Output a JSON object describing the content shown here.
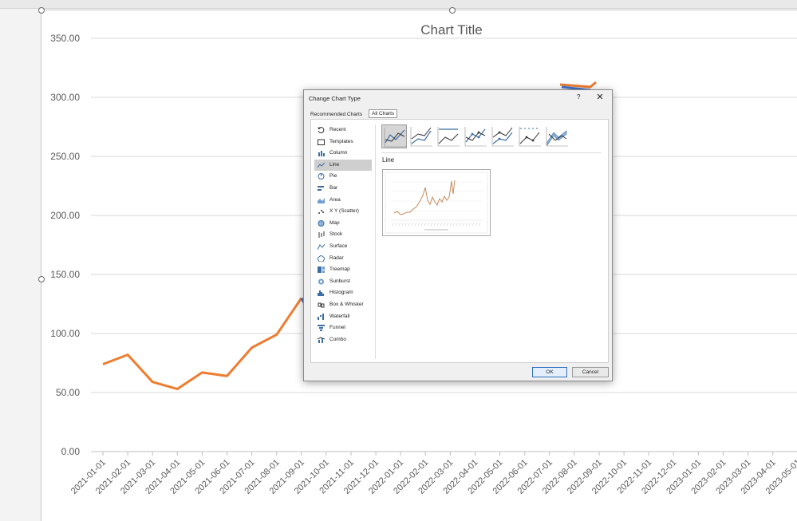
{
  "chart": {
    "title": "Chart Title",
    "y_ticks": [
      "350.00",
      "300.00",
      "250.00",
      "200.00",
      "150.00",
      "100.00",
      "50.00",
      "0.00"
    ],
    "x_ticks": [
      "2021-01-01",
      "2021-02-01",
      "2021-03-01",
      "2021-04-01",
      "2021-05-01",
      "2021-06-01",
      "2021-07-01",
      "2021-08-01",
      "2021-09-01",
      "2021-10-01",
      "2021-11-01",
      "2021-12-01",
      "2022-01-01",
      "2022-02-01",
      "2022-03-01",
      "2022-04-01",
      "2022-05-01",
      "2022-06-01",
      "2022-07-01",
      "2022-08-01",
      "2022-09-01",
      "2022-10-01",
      "2022-11-01",
      "2022-12-01",
      "2023-01-01",
      "2023-02-01",
      "2023-03-01",
      "2023-04-01",
      "2023-05-01"
    ],
    "series_color": "#ed7d31",
    "hidden_series_color": "#4472c4"
  },
  "chart_data": {
    "type": "line",
    "title": "Chart Title",
    "ylim": [
      0,
      350
    ],
    "grid": true,
    "categories": [
      "2021-01-01",
      "2021-02-01",
      "2021-03-01",
      "2021-04-01",
      "2021-05-01",
      "2021-06-01",
      "2021-07-01",
      "2021-08-01",
      "2021-09-01",
      "2021-10-01",
      "2021-11-01",
      "2021-12-01",
      "2022-01-01",
      "2022-02-01",
      "2022-03-01",
      "2022-04-01",
      "2022-05-01",
      "2022-06-01",
      "2022-07-01",
      "2022-08-01",
      "2022-09-01",
      "2022-10-01",
      "2022-11-01",
      "2022-12-01",
      "2023-01-01",
      "2023-02-01",
      "2023-03-01",
      "2023-04-01",
      "2023-05-01"
    ],
    "series": [
      {
        "values": [
          74,
          82,
          59,
          53,
          67,
          64,
          88,
          99,
          130,
          null,
          null,
          null,
          null,
          null,
          null,
          null,
          null,
          null,
          null,
          null,
          310,
          null,
          null,
          null,
          null,
          null,
          null,
          null,
          null
        ]
      }
    ]
  },
  "dialog": {
    "title": "Change Chart Type",
    "help": "?",
    "close": "✕",
    "tabs": {
      "recommended": "Recommended Charts",
      "all": "All Charts"
    },
    "selected_type_label": "Line",
    "ok": "OK",
    "cancel": "Cancel",
    "types": [
      {
        "label": "Recent",
        "icon": "recent-icon"
      },
      {
        "label": "Templates",
        "icon": "templates-icon"
      },
      {
        "label": "Column",
        "icon": "column-chart-icon"
      },
      {
        "label": "Line",
        "icon": "line-chart-icon"
      },
      {
        "label": "Pie",
        "icon": "pie-chart-icon"
      },
      {
        "label": "Bar",
        "icon": "bar-chart-icon"
      },
      {
        "label": "Area",
        "icon": "area-chart-icon"
      },
      {
        "label": "X Y (Scatter)",
        "icon": "scatter-chart-icon"
      },
      {
        "label": "Map",
        "icon": "map-chart-icon"
      },
      {
        "label": "Stock",
        "icon": "stock-chart-icon"
      },
      {
        "label": "Surface",
        "icon": "surface-chart-icon"
      },
      {
        "label": "Radar",
        "icon": "radar-chart-icon"
      },
      {
        "label": "Treemap",
        "icon": "treemap-chart-icon"
      },
      {
        "label": "Sunburst",
        "icon": "sunburst-chart-icon"
      },
      {
        "label": "Histogram",
        "icon": "histogram-chart-icon"
      },
      {
        "label": "Box & Whisker",
        "icon": "box-whisker-chart-icon"
      },
      {
        "label": "Waterfall",
        "icon": "waterfall-chart-icon"
      },
      {
        "label": "Funnel",
        "icon": "funnel-chart-icon"
      },
      {
        "label": "Combo",
        "icon": "combo-chart-icon"
      }
    ],
    "selected_index": 3,
    "subtypes": [
      "line-subtype-icon",
      "stacked-line-subtype-icon",
      "100-stacked-line-subtype-icon",
      "line-markers-subtype-icon",
      "stacked-line-markers-subtype-icon",
      "100-stacked-line-markers-subtype-icon",
      "3d-line-subtype-icon"
    ],
    "selected_subtype": 0
  }
}
